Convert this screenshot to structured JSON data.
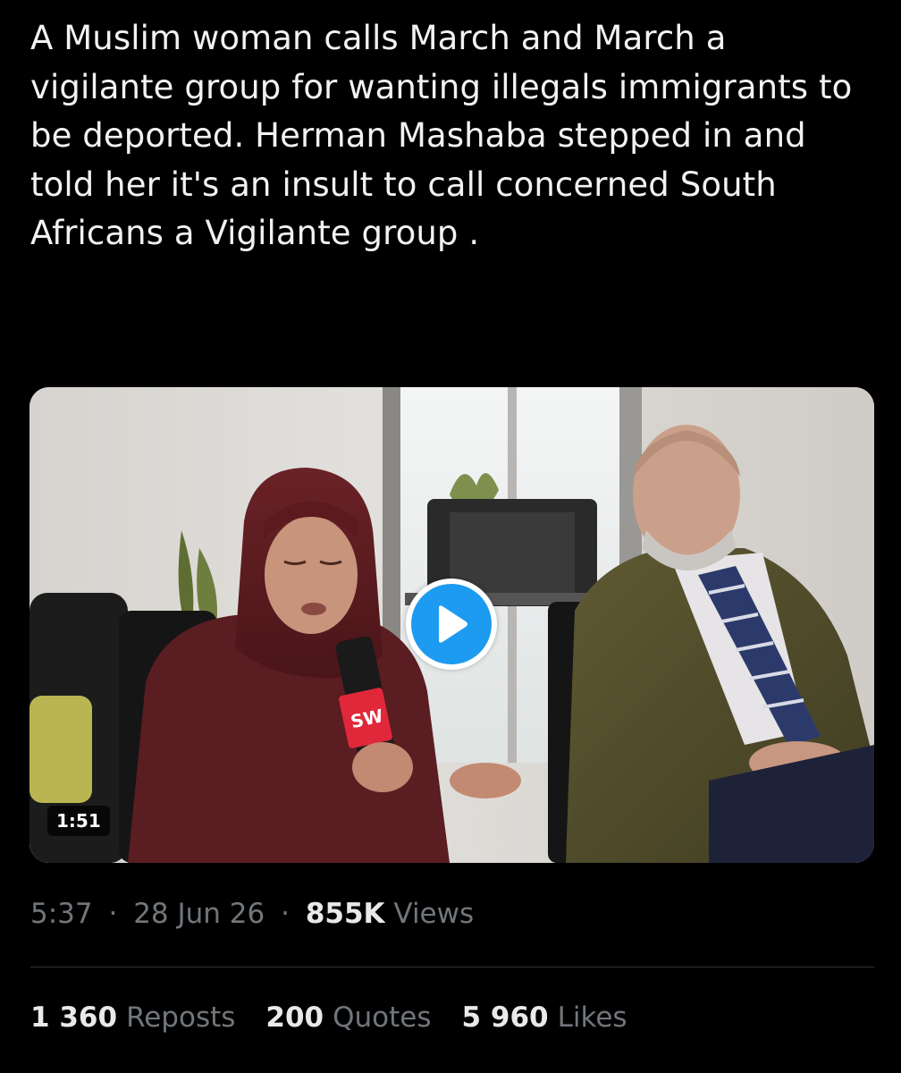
{
  "post": {
    "text": "A Muslim woman calls March and March a vigilante group for wanting illegals immigrants to be deported. Herman Mashaba stepped in and told her it's an insult to call concerned South Africans a Vigilante group ."
  },
  "video": {
    "duration": "1:51",
    "mic_logo": "SW",
    "icon": "play-icon"
  },
  "meta": {
    "time": "5:37",
    "separator": "·",
    "date": "28 Jun 26",
    "views_count": "855K",
    "views_label": "Views"
  },
  "stats": {
    "reposts_count": "1 360",
    "reposts_label": "Reposts",
    "quotes_count": "200",
    "quotes_label": "Quotes",
    "likes_count": "5 960",
    "likes_label": "Likes"
  },
  "colors": {
    "background": "#000000",
    "text": "#e7e9ea",
    "muted": "#71767b",
    "accent": "#1d9bf0",
    "divider": "#2f3336"
  }
}
